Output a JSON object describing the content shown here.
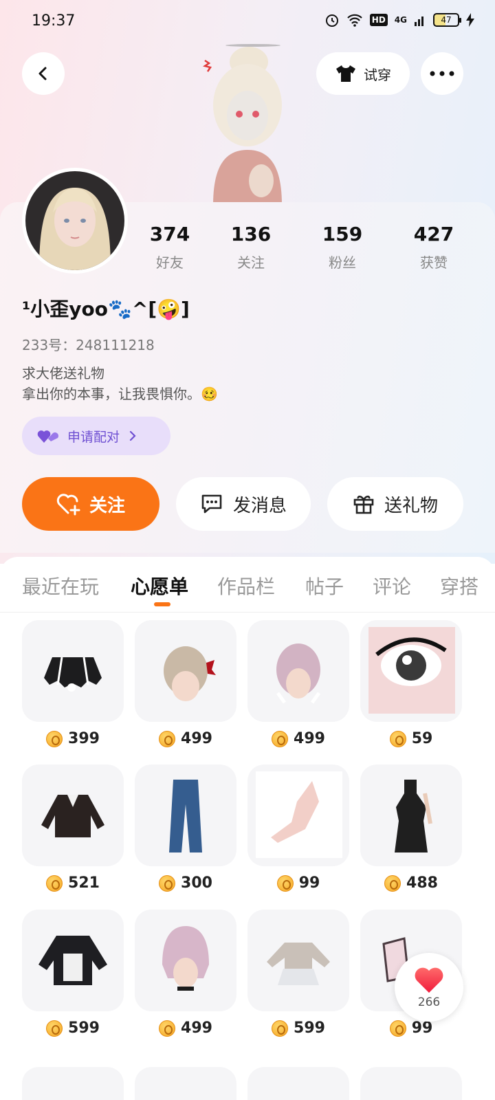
{
  "status_bar": {
    "time": "19:37",
    "battery": "47",
    "network": "4G",
    "hd": "HD"
  },
  "header": {
    "try_on_label": "试穿"
  },
  "profile": {
    "stats": [
      {
        "value": "374",
        "label": "好友"
      },
      {
        "value": "136",
        "label": "关注"
      },
      {
        "value": "159",
        "label": "粉丝"
      },
      {
        "value": "427",
        "label": "获赞"
      }
    ],
    "nickname": "¹小歪yoo🐾^[🤪]",
    "uid": "233号：248111218",
    "bio_line1": "求大佬送礼物",
    "bio_line2": "拿出你的本事，让我畏惧你。🥴",
    "pair_label": "申请配对"
  },
  "actions": {
    "follow": "关注",
    "message": "发消息",
    "gift": "送礼物"
  },
  "tabs": [
    "最近在玩",
    "心愿单",
    "作品栏",
    "帖子",
    "评论",
    "穿搭"
  ],
  "active_tab": "心愿单",
  "wishlist": [
    {
      "price": "399",
      "item": "black skirt"
    },
    {
      "price": "499",
      "item": "bun hairstyle"
    },
    {
      "price": "499",
      "item": "braided hair"
    },
    {
      "price": "59",
      "item": "eye"
    },
    {
      "price": "521",
      "item": "jacket"
    },
    {
      "price": "300",
      "item": "jeans"
    },
    {
      "price": "99",
      "item": "hand"
    },
    {
      "price": "488",
      "item": "black dress"
    },
    {
      "price": "599",
      "item": "hoodie"
    },
    {
      "price": "499",
      "item": "bob hair"
    },
    {
      "price": "599",
      "item": "sweater skirt"
    },
    {
      "price": "99",
      "item": "item"
    }
  ],
  "like_count": "266",
  "colors": {
    "accent": "#fa7416",
    "pair_bg": "#e8defa",
    "pair_text": "#6e4fd2"
  }
}
